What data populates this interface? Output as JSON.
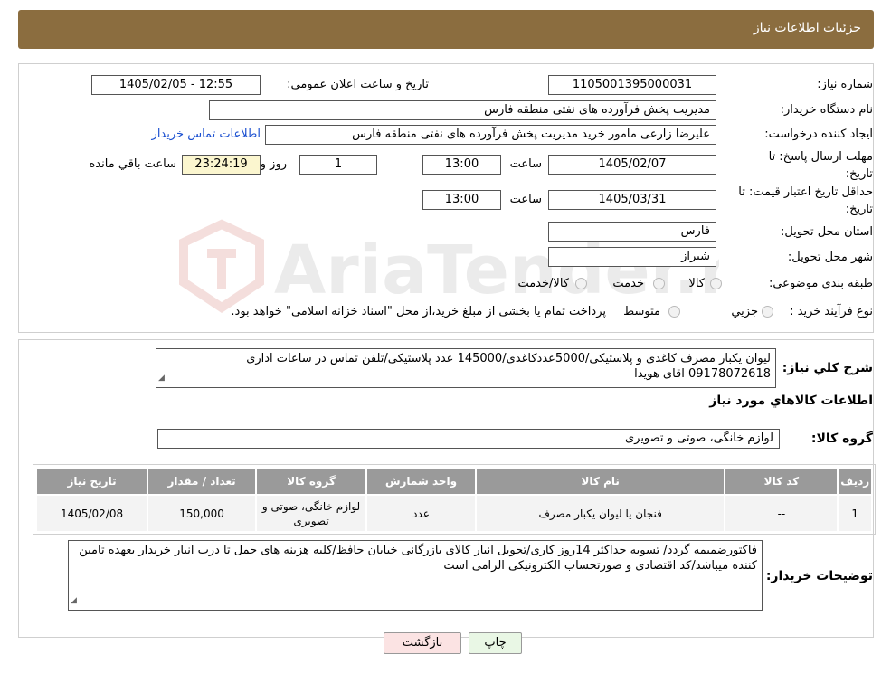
{
  "header": {
    "title": "جزئیات اطلاعات نیاز"
  },
  "fields": {
    "need_number_label": "شماره نیاز:",
    "need_number": "1105001395000031",
    "announce_label": "تاریخ و ساعت اعلان عمومی:",
    "announce_value": "1405/02/05 - 12:55",
    "buyer_org_label": "نام دستگاه خریدار:",
    "buyer_org": "مدیریت پخش فرآورده های نفتی منطقه فارس",
    "requester_label": "ایجاد کننده درخواست:",
    "requester": "علیرضا زارعی مامور خرید مدیریت پخش فرآورده های نفتی منطقه فارس",
    "contact_link": "اطلاعات تماس خریدار",
    "deadline_label_1": "مهلت ارسال پاسخ: تا",
    "deadline_label_2": "تاریخ:",
    "deadline_date": "1405/02/07",
    "time_label": "ساعت",
    "deadline_time": "13:00",
    "days_value": "1",
    "days_label": "روز و",
    "remaining_time": "23:24:19",
    "remaining_label": "ساعت باقي مانده",
    "validity_label_1": "حداقل تاریخ اعتبار قیمت: تا",
    "validity_label_2": "تاریخ:",
    "validity_date": "1405/03/31",
    "validity_time": "13:00",
    "province_label": "استان محل تحویل:",
    "province": "فارس",
    "city_label": "شهر محل تحویل:",
    "city": "شیراز",
    "category_label": "طبقه بندی موضوعی:",
    "category_options": [
      "کالا",
      "خدمت",
      "کالا/خدمت"
    ],
    "process_label": "نوع فرآیند خرید :",
    "process_options": [
      "جزیي",
      "متوسط"
    ],
    "process_note": "پرداخت تمام یا بخشی از مبلغ خرید،از محل \"اسناد خزانه اسلامی\" خواهد بود."
  },
  "summary": {
    "label": "شرح کلي نياز:",
    "text": "لیوان یکبار مصرف کاغذی و پلاستیکی/5000عددکاغذی/145000 عدد پلاستیکی/تلفن تماس در ساعات اداری 09178072618 اقای هویدا"
  },
  "goods_section_title": "اطلاعات کالاهاي مورد نياز",
  "goods_group": {
    "label": "گروه کالا:",
    "value": "لوازم خانگی، صوتی و تصویری"
  },
  "table": {
    "headers": [
      "ردیف",
      "کد کالا",
      "نام کالا",
      "واحد شمارش",
      "گروه کالا",
      "تعداد / مقدار",
      "تاریخ نیاز"
    ],
    "rows": [
      [
        "1",
        "--",
        "فنجان یا لیوان یکبار مصرف",
        "عدد",
        "لوازم خانگی، صوتی و تصویری",
        "150,000",
        "1405/02/08"
      ]
    ]
  },
  "buyer_notes": {
    "label": "توضیحات خریدار:",
    "text": "فاکتورضمیمه گردد/ تسویه حداکثر 14روز کاری/تحویل انبار کالای بازرگانی خیابان حافظ/کلیه هزینه های حمل تا درب انبار خریدار بعهده تامین کننده میباشد/کد اقتصادی و صورتحساب الکترونیکی الزامی است"
  },
  "buttons": {
    "print": "چاپ",
    "back": "بازگشت"
  },
  "watermark": "AriaTender.neT",
  "colors": {
    "header": "#8b6d3f",
    "link": "#1a4fd0",
    "table_header": "#9a9a9a",
    "remaining_bg": "#fbf6cf"
  }
}
